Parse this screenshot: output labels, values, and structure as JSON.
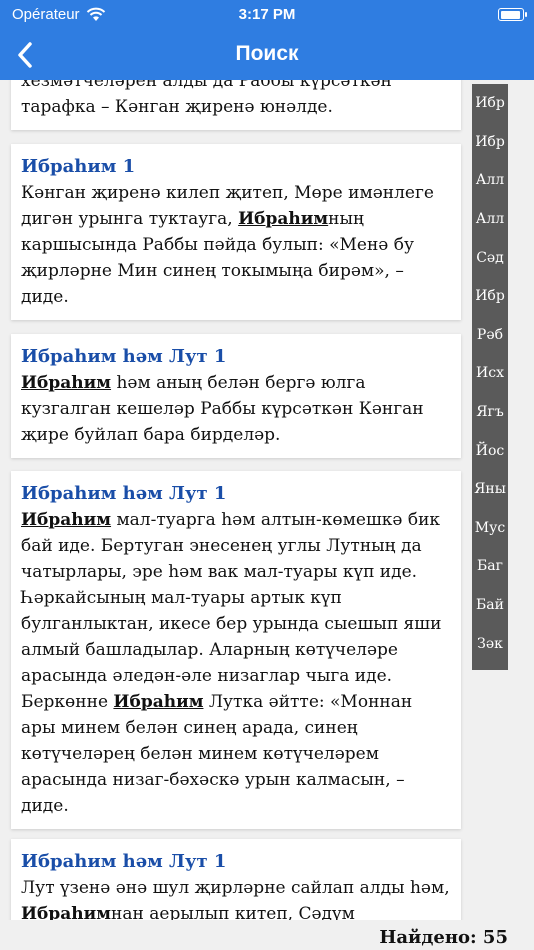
{
  "status": {
    "carrier": "Opérateur",
    "time": "3:17 PM"
  },
  "nav": {
    "title": "Поиск"
  },
  "cards": [
    {
      "heading": "",
      "parts": [
        "хезмәтчеләрен алды да Раббы күрсәткән тарафка – Кәнган җиренә юнәлде."
      ]
    },
    {
      "heading": "Ибраһим 1",
      "parts": [
        "Кәнган җиренә килеп җитеп, Мөре имәнлеге дигән урынга туктауга, ",
        "Ибраһим",
        "ның каршысында Раббы пәйда булып: «Менә бу җирләрне Мин синең токымыңа бирәм», – диде."
      ]
    },
    {
      "heading": "Ибраһим һәм Лут 1",
      "parts": [
        "",
        "Ибраһим",
        " һәм аның белән бергә юлга кузгалган кешеләр Раббы күрсәткән Кәнган җире буйлап бара бирделәр."
      ]
    },
    {
      "heading": "Ибраһим һәм Лут 1",
      "parts": [
        "",
        "Ибраһим",
        " мал-туарга һәм алтын-көмешкә бик бай иде. Бертуган энесенең углы Лутның да чатырлары, эре һәм вак мал-туары күп иде. Һәркайсының мал-туары артык күп булганлыктан, икесе бер урында сыешып яши алмый башладылар. Аларның көтүчеләре арасында әледән-әле низаглар чыга иде. Беркөнне ",
        "Ибраһим",
        " Лутка әйтте: «Моннан ары минем белән синең арада, синең көтүчеләрең белән минем көтүчеләрем арасында низаг-бәхәскә урын калмасын, – диде."
      ]
    },
    {
      "heading": "Ибраһим һәм Лут 1",
      "parts": [
        "Лут үзенә әнә шул җирләрне сайлап алды һәм, ",
        "Ибраһим",
        "нан аерылып китеп, Сәдүм"
      ]
    }
  ],
  "index": [
    "Ибр",
    "Ибр",
    "Алл",
    "Алл",
    "Сәд",
    "Ибр",
    "Рәб",
    "Исх",
    "Ягъ",
    "Йос",
    "Яны",
    "Мус",
    "Баг",
    "Бай",
    "Зәк"
  ],
  "found": "Найдено: 55"
}
